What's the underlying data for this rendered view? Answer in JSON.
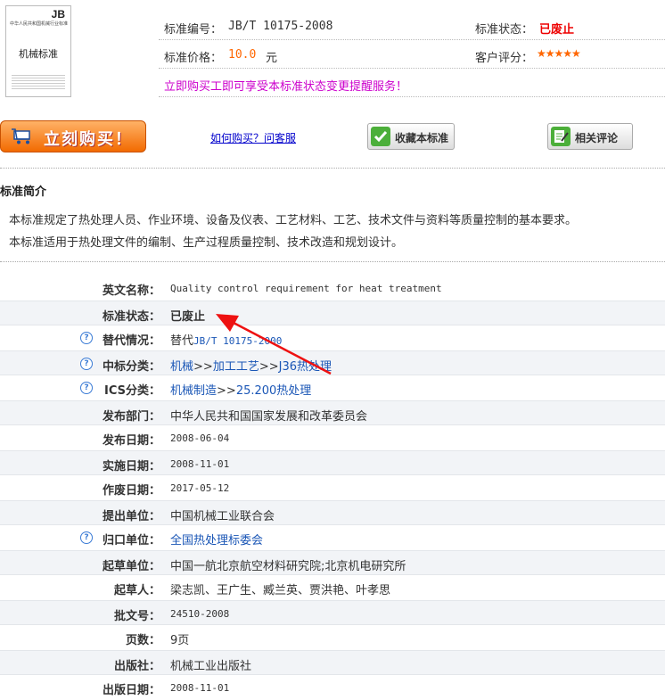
{
  "cover": {
    "code": "JB",
    "small_text": "中华人民共和国机械行业标准",
    "title": "机械标准"
  },
  "info": {
    "std_no_label": "标准编号：",
    "std_no": "JB/T 10175-2008",
    "status_label": "标准状态：",
    "status": "已废止",
    "price_label": "标准价格：",
    "price": "10.0",
    "price_unit": "元",
    "rating_label": "客户评分：",
    "rating": "★★★★★",
    "promo": "立即购买工即可享受本标准状态变更提醒服务！"
  },
  "actions": {
    "buy": "立刻购买！",
    "how_to_buy": "如何购买？问客服",
    "favorite": "收藏本标准",
    "comments": "相关评论"
  },
  "intro": {
    "title": "标准简介",
    "lines": [
      "本标准规定了热处理人员、作业环境、设备及仪表、工艺材料、工艺、技术文件与资料等质量控制的基本要求。",
      "本标准适用于热处理文件的编制、生产过程质量控制、技术改造和规划设计。"
    ]
  },
  "details": {
    "english_name": {
      "label": "英文名称：",
      "value": "Quality control requirement for heat treatment"
    },
    "status": {
      "label": "标准状态：",
      "value": "已废止"
    },
    "replace": {
      "label": "替代情况：",
      "prefix": "替代",
      "link": "JB/T 10175-2000"
    },
    "ccs": {
      "label": "中标分类：",
      "a": "机械",
      "sep1": ">>",
      "b": "加工工艺",
      "sep2": ">>",
      "c": "J36热处理"
    },
    "ics": {
      "label": "ICS分类：",
      "a": "机械制造",
      "sep": ">>",
      "b": "25.200热处理"
    },
    "publisher_dept": {
      "label": "发布部门：",
      "value": "中华人民共和国国家发展和改革委员会"
    },
    "publish_date": {
      "label": "发布日期：",
      "value": "2008-06-04"
    },
    "impl_date": {
      "label": "实施日期：",
      "value": "2008-11-01"
    },
    "abolish_date": {
      "label": "作废日期：",
      "value": "2017-05-12"
    },
    "proposer": {
      "label": "提出单位：",
      "value": "中国机械工业联合会"
    },
    "tc": {
      "label": "归口单位：",
      "value": "全国热处理标委会"
    },
    "drafter_unit": {
      "label": "起草单位：",
      "value": "中国一航北京航空材料研究院;北京机电研究所"
    },
    "drafters": {
      "label": "起草人：",
      "value": "梁志凯、王广生、臧兰英、贾洪艳、叶孝思"
    },
    "approval_no": {
      "label": "批文号：",
      "value": "24510-2008"
    },
    "pages": {
      "label": "页数：",
      "value": "9页"
    },
    "press": {
      "label": "出版社：",
      "value": "机械工业出版社"
    },
    "pub_date": {
      "label": "出版日期：",
      "value": "2008-11-01"
    }
  },
  "colors": {
    "accent_red": "#ee0000",
    "price_orange": "#ff6600",
    "promo": "#cc00cc",
    "link": "#1a56b6"
  }
}
